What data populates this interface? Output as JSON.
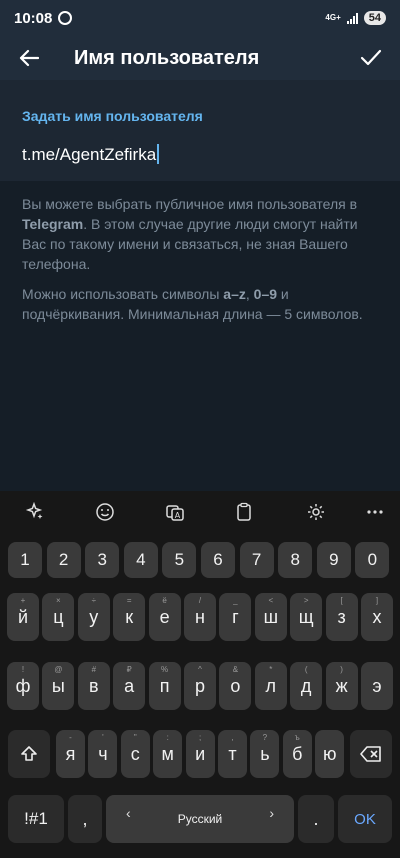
{
  "status_bar": {
    "time": "10:08",
    "network": "4G+",
    "battery": "54"
  },
  "app_bar": {
    "title": "Имя пользователя",
    "back_icon": "arrow-left-icon",
    "confirm_icon": "checkmark-icon"
  },
  "username_card": {
    "label": "Задать имя пользователя",
    "value": "t.me/AgentZefirka"
  },
  "info": {
    "p1_before": "Вы можете выбрать публичное имя пользователя в ",
    "p1_bold": "Telegram",
    "p1_after": ". В этом случае другие люди смогут найти Вас по такому имени и связаться, не зная Вашего телефона.",
    "p2_before": "Можно использовать символы ",
    "p2_bold1": "a–z",
    "p2_mid": ", ",
    "p2_bold2": "0–9",
    "p2_after": " и подчёркивания. Минимальная длина — 5 символов."
  },
  "keyboard": {
    "toolbar": [
      "sparkle-icon",
      "emoji-icon",
      "translate-icon",
      "clipboard-icon",
      "settings-icon",
      "more-icon"
    ],
    "row_numbers": [
      "1",
      "2",
      "3",
      "4",
      "5",
      "6",
      "7",
      "8",
      "9",
      "0"
    ],
    "row1": [
      {
        "key": "й",
        "hint": "+"
      },
      {
        "key": "ц",
        "hint": "×"
      },
      {
        "key": "у",
        "hint": "÷"
      },
      {
        "key": "к",
        "hint": "="
      },
      {
        "key": "е",
        "hint": "ё"
      },
      {
        "key": "н",
        "hint": "/"
      },
      {
        "key": "г",
        "hint": "_"
      },
      {
        "key": "ш",
        "hint": "<"
      },
      {
        "key": "щ",
        "hint": ">"
      },
      {
        "key": "з",
        "hint": "["
      },
      {
        "key": "х",
        "hint": "]"
      }
    ],
    "row2": [
      {
        "key": "ф",
        "hint": "!"
      },
      {
        "key": "ы",
        "hint": "@"
      },
      {
        "key": "в",
        "hint": "#"
      },
      {
        "key": "а",
        "hint": "₽"
      },
      {
        "key": "п",
        "hint": "%"
      },
      {
        "key": "р",
        "hint": "^"
      },
      {
        "key": "о",
        "hint": "&"
      },
      {
        "key": "л",
        "hint": "*"
      },
      {
        "key": "д",
        "hint": "("
      },
      {
        "key": "ж",
        "hint": ")"
      },
      {
        "key": "э",
        "hint": ""
      }
    ],
    "row3": [
      {
        "key": "я",
        "hint": "-"
      },
      {
        "key": "ч",
        "hint": "'"
      },
      {
        "key": "с",
        "hint": "\""
      },
      {
        "key": "м",
        "hint": ":"
      },
      {
        "key": "и",
        "hint": ";"
      },
      {
        "key": "т",
        "hint": ","
      },
      {
        "key": "ь",
        "hint": "?"
      },
      {
        "key": "б",
        "hint": "ъ"
      },
      {
        "key": "ю",
        "hint": ""
      }
    ],
    "shift_icon": "shift-icon",
    "backspace_icon": "backspace-icon",
    "symbols_label": "!#1",
    "comma_label": ",",
    "space_label": "Русский",
    "space_left": "‹",
    "space_right": "›",
    "period_label": ".",
    "ok_label": "OK"
  }
}
